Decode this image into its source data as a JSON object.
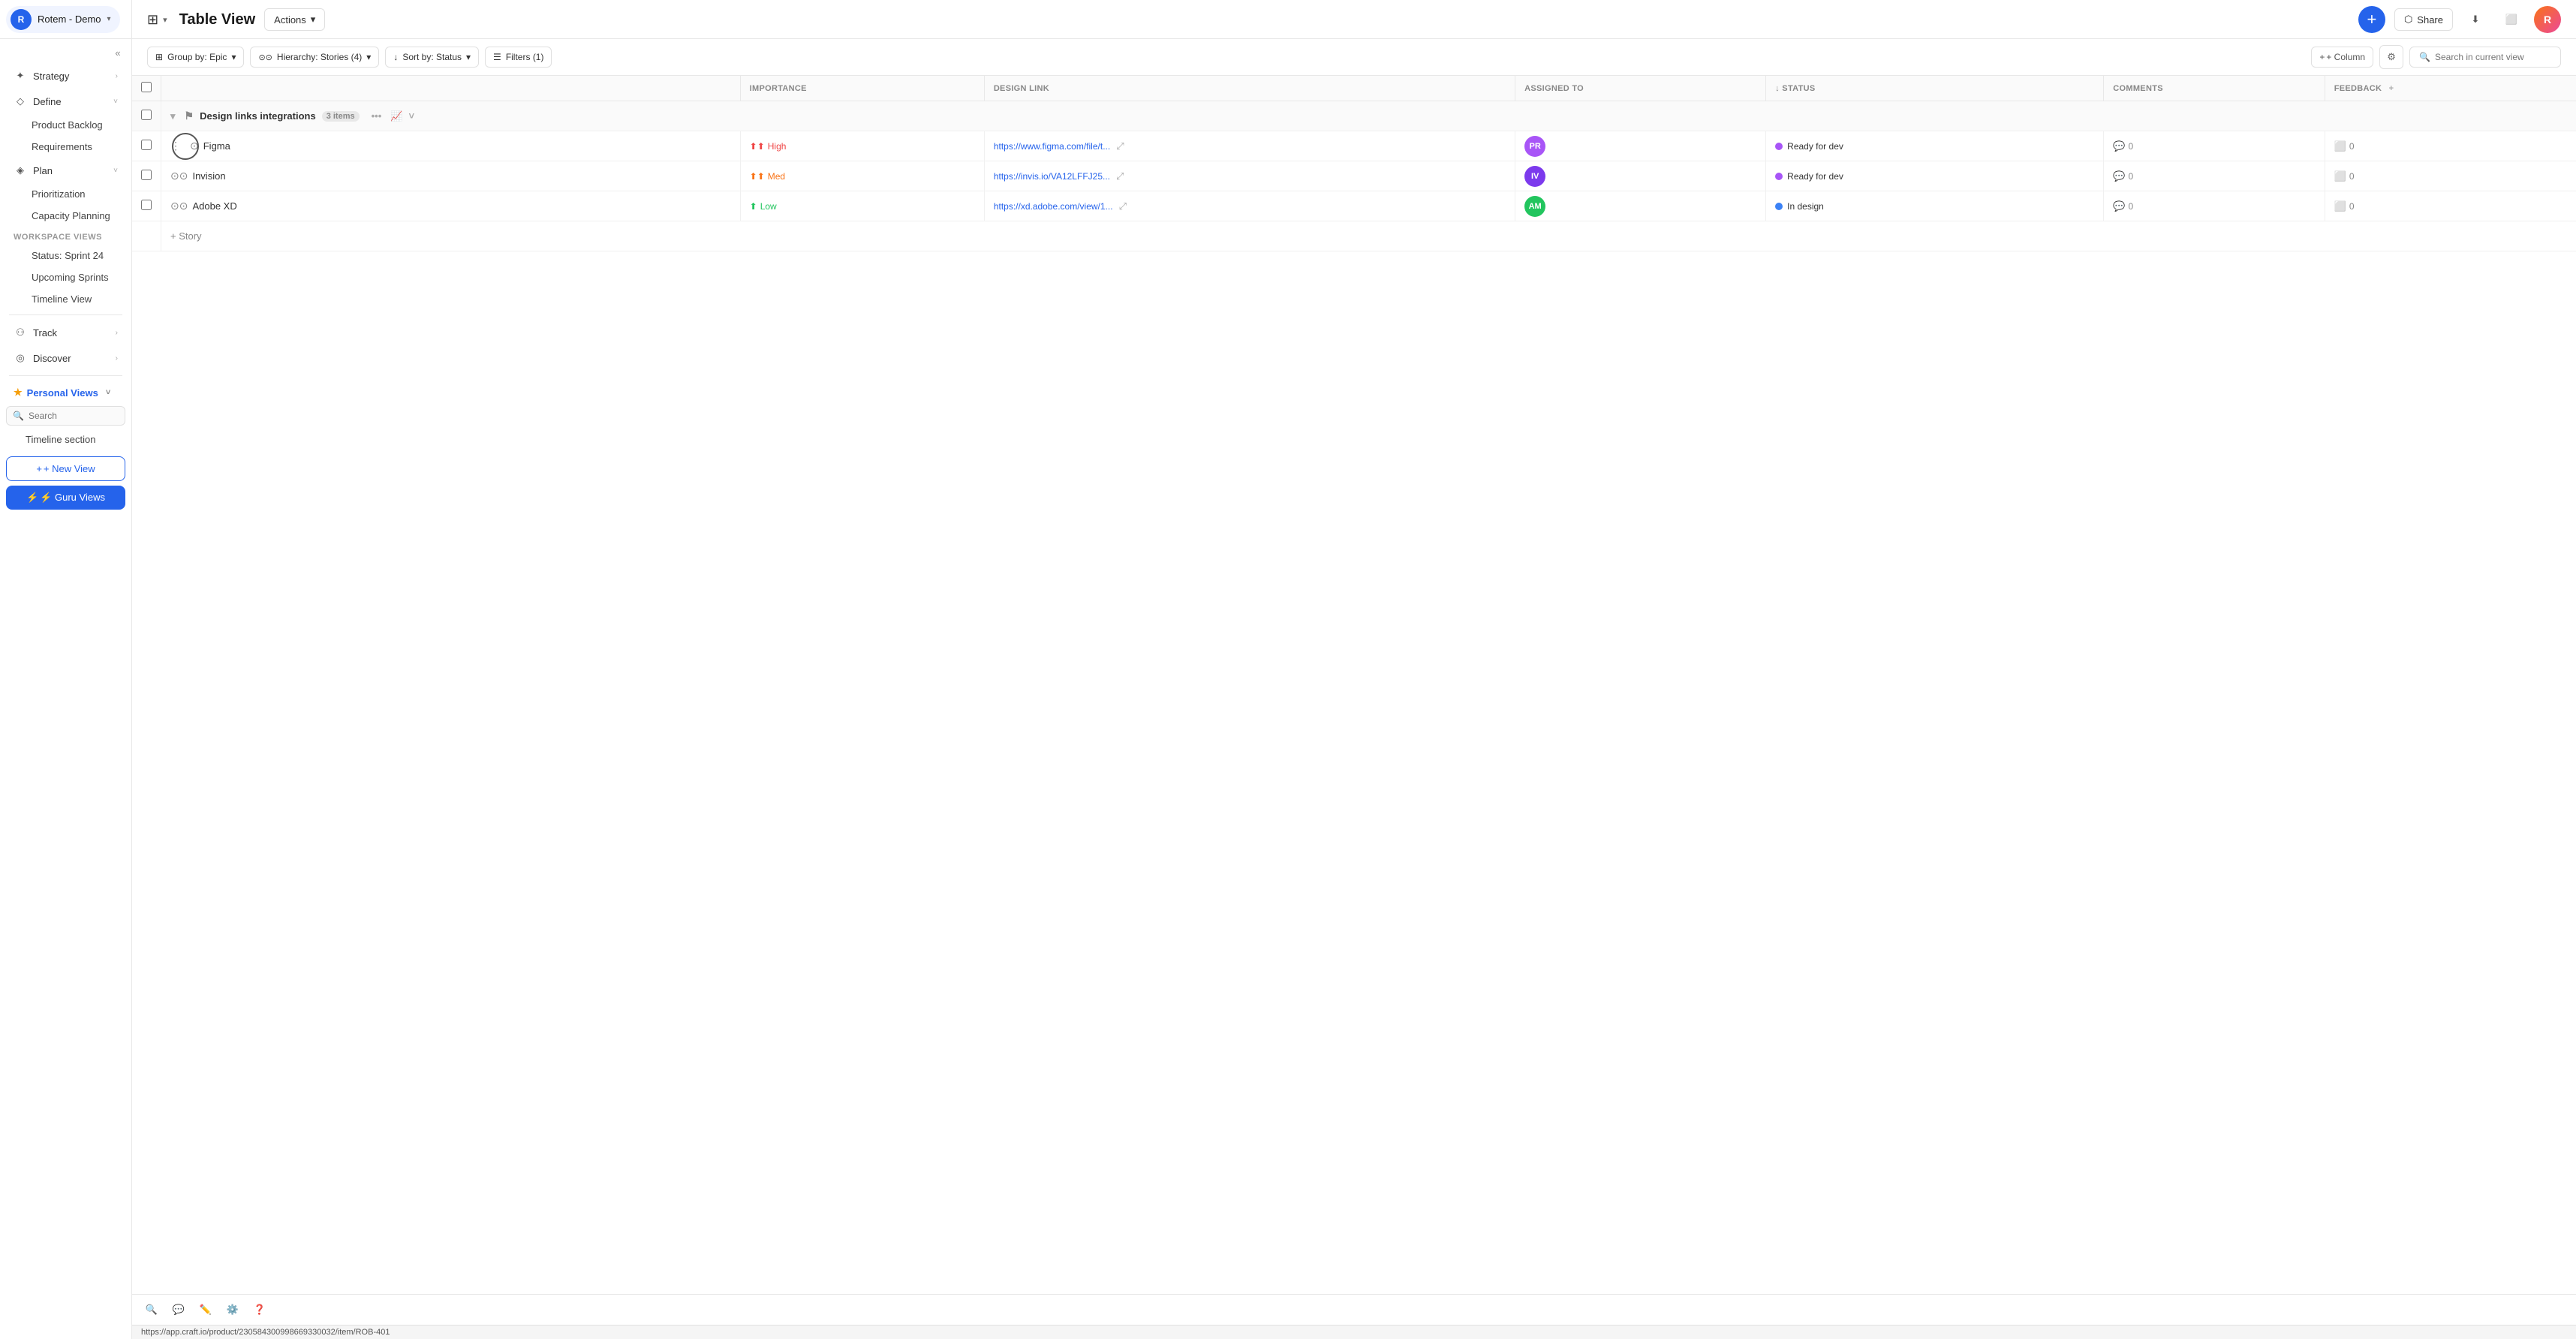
{
  "workspace": {
    "name": "Rotem - Demo",
    "avatar_initials": "R"
  },
  "header": {
    "view_icon": "⊞",
    "view_title": "Table View",
    "actions_label": "Actions",
    "share_label": "Share"
  },
  "toolbar": {
    "group_by": "Group by: Epic",
    "hierarchy": "Hierarchy: Stories (4)",
    "sort_by": "Sort by: Status",
    "filters": "Filters (1)",
    "add_column": "+ Column",
    "search_placeholder": "Search in current view"
  },
  "sidebar": {
    "strategy_label": "Strategy",
    "define_label": "Define",
    "define_sub": [
      {
        "label": "Product Backlog",
        "active": false
      },
      {
        "label": "Requirements",
        "active": false
      }
    ],
    "plan_label": "Plan",
    "plan_sub": [
      {
        "label": "Prioritization",
        "active": false
      },
      {
        "label": "Capacity Planning",
        "active": false
      }
    ],
    "workspace_views_label": "WORKSPACE VIEWS",
    "workspace_views": [
      {
        "label": "Status: Sprint 24",
        "active": false
      },
      {
        "label": "Upcoming Sprints",
        "active": false
      },
      {
        "label": "Timeline View",
        "active": false
      }
    ],
    "track_label": "Track",
    "discover_label": "Discover",
    "personal_views_label": "Personal Views",
    "search_placeholder": "Search",
    "timeline_item": "Timeline section",
    "new_view_label": "+ New View",
    "guru_views_label": "⚡ Guru Views"
  },
  "table": {
    "group_name": "Design links integrations",
    "group_count": "3 items",
    "columns": [
      {
        "key": "importance",
        "label": "IMPORTANCE"
      },
      {
        "key": "design_link",
        "label": "DESIGN LINK"
      },
      {
        "key": "assigned_to",
        "label": "ASSIGNED TO"
      },
      {
        "key": "status",
        "label": "↓ STATUS"
      },
      {
        "key": "comments",
        "label": "COMMENTS"
      },
      {
        "key": "feedback",
        "label": "FEEDBACK"
      }
    ],
    "rows": [
      {
        "name": "Figma",
        "importance": "High",
        "importance_level": "high",
        "design_link": "https://www.figma.com/file/t...",
        "assigned_avatar_color": "#a855f7",
        "assigned_initials": "PR",
        "status": "Ready for dev",
        "status_type": "ready",
        "comments": "0",
        "feedback": "0",
        "highlight": true
      },
      {
        "name": "Invision",
        "importance": "Med",
        "importance_level": "med",
        "design_link": "https://invis.io/VA12LFFJ25...",
        "assigned_avatar_color": "#7c3aed",
        "assigned_initials": "IV",
        "status": "Ready for dev",
        "status_type": "ready",
        "comments": "0",
        "feedback": "0",
        "highlight": false
      },
      {
        "name": "Adobe XD",
        "importance": "Low",
        "importance_level": "low",
        "design_link": "https://xd.adobe.com/view/1...",
        "assigned_avatar_color": "#22c55e",
        "assigned_initials": "AM",
        "status": "In design",
        "status_type": "indesign",
        "comments": "0",
        "feedback": "0",
        "highlight": false
      }
    ],
    "add_story_label": "+ Story"
  },
  "status_bar": {
    "url": "https://app.craft.io/product/230584300998669330032/item/ROB-401"
  },
  "bottom_icons": [
    "🔍",
    "💬",
    "✏️",
    "⚙️",
    "❓"
  ]
}
